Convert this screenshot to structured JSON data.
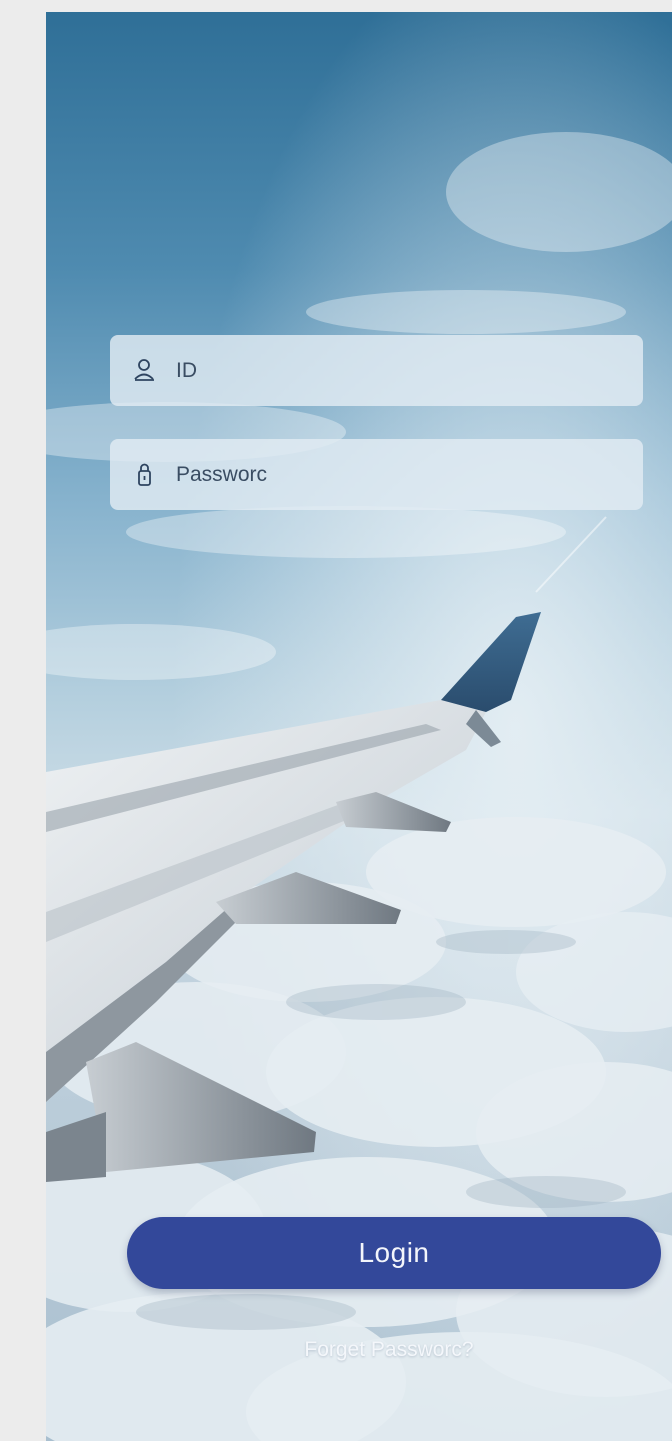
{
  "login_form": {
    "id_field": {
      "placeholder": "ID",
      "value": "",
      "icon": "user-icon"
    },
    "password_field": {
      "placeholder": "Passworc",
      "value": "",
      "icon": "lock-icon"
    },
    "login_label": "Login",
    "forgot_label": "Forget Passworc?"
  },
  "colors": {
    "login_button": "#33489a",
    "field_background": "#e2ecf3",
    "sky_top": "#3f7fa6",
    "clouds": "#d9e3ea"
  }
}
